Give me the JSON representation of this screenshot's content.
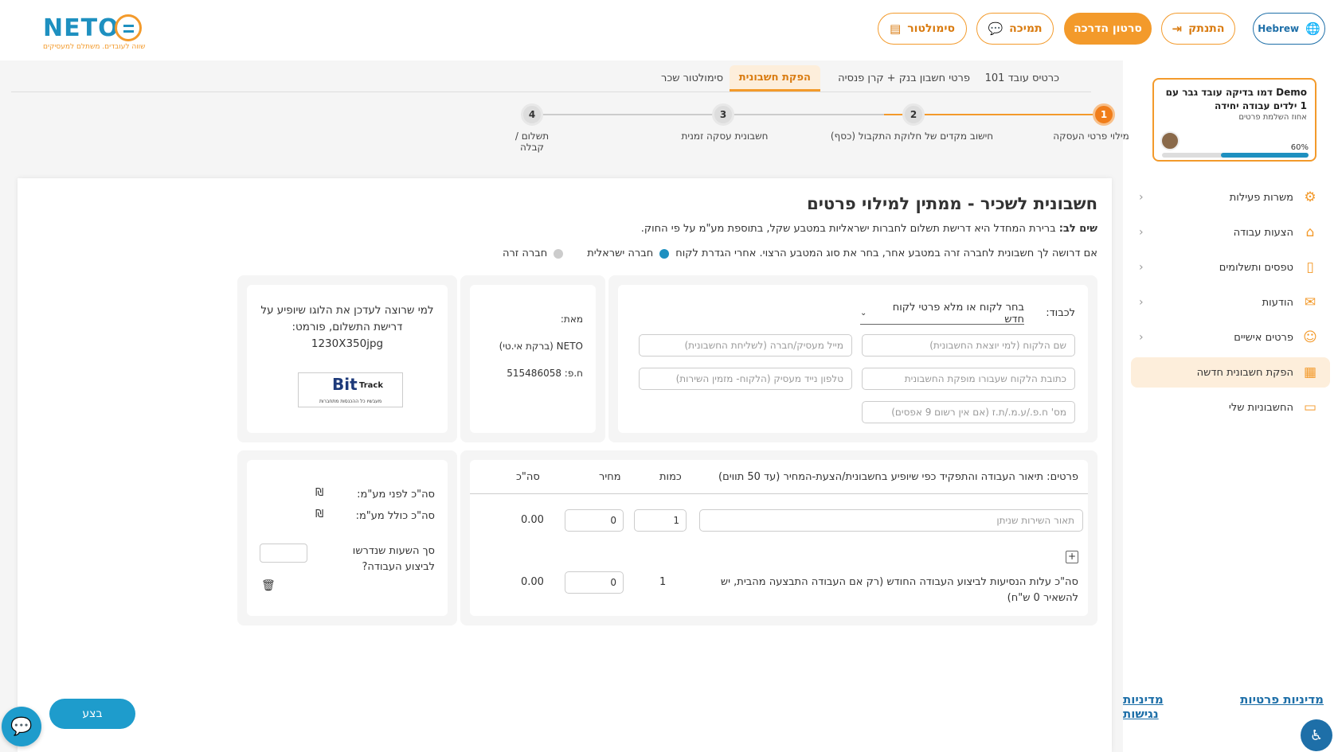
{
  "header": {
    "logo_text": "NETO",
    "logo_tagline": "שווה לעובדים. משתלם למעסיקים",
    "language_label": "Hebrew",
    "login_label": "התנתק",
    "guide_video_label": "סרטון הדרכה",
    "support_label": "תמיכה",
    "simulator_label": "סימולטור"
  },
  "demo_card": {
    "title": "Demo דמו בדיקה עובד גבר עם 1 ילדים עבודה יחידה",
    "subtitle": "אחוז השלמת פרטים",
    "percent_label": "60%",
    "percent": 0.6
  },
  "sidebar": {
    "items": [
      {
        "label": "משרות פעילות",
        "icon": "gear-icon"
      },
      {
        "label": "הצעות עבודה",
        "icon": "chair-icon"
      },
      {
        "label": "טפסים ותשלומים",
        "icon": "document-icon"
      },
      {
        "label": "הודעות",
        "icon": "envelope-icon"
      },
      {
        "label": "פרטים אישיים",
        "icon": "user-icon"
      },
      {
        "label": "הפקת חשבונית חדשה",
        "icon": "invoice-icon"
      },
      {
        "label": "החשבוניות שלי",
        "icon": "folder-icon"
      }
    ],
    "privacy_label": "מדיניות פרטיות",
    "accessibility_label": "מדיניות נגישות"
  },
  "tabs": [
    {
      "label": "כרטיס עובד 101"
    },
    {
      "label": "פרטי חשבון בנק + קרן פנסיה"
    },
    {
      "label": "הפקת חשבונית"
    },
    {
      "label": "סימולטור שכר"
    }
  ],
  "steps": [
    {
      "number": "1",
      "label": "מילוי פרטי העסקה"
    },
    {
      "number": "2",
      "label": "חישוב מקדים של חלוקת התקבול (כסף)"
    },
    {
      "number": "3",
      "label": "חשבונית עסקה זמנית"
    },
    {
      "number": "4",
      "label": "תשלום / קבלה"
    }
  ],
  "page": {
    "title": "חשבונית לשכיר - ממתין למילוי פרטים",
    "note_bold": "שים לב:",
    "note_text": "ברירת המחדל היא דרישת תשלום לחברות ישראליות במטבע שקל, בתוספת מע\"מ על פי החוק.",
    "currency_text": "אם דרושה לך חשבונית לחברה זרה במטבע אחר, בחר את סוג המטבע הרצוי. אחרי הגדרת לקוח",
    "radio_israeli": "חברה ישראלית",
    "radio_foreign": "חברה זרה"
  },
  "customer": {
    "to_label": "לכבוד:",
    "select_value": "בחר לקוח או מלא פרטי לקוח חדש",
    "customer_name_ph": "שם הלקוח (למי יוצאת החשבונית)",
    "employer_email_ph": "מייל מעסיק/חברה (לשליחת החשבונית)",
    "customer_address_ph": "כתובת הלקוח שעבורו מופקת החשבונית",
    "employer_phone_ph": "טלפון נייד מעסיק (הלקוח- מזמין השירות)",
    "tax_id_ph": "מס' ח.פ./ע.מ./ת.ז (אם אין רשום 9 אפסים)"
  },
  "from": {
    "label": "מאת:",
    "company": "NETO (ברקת אי.טי)",
    "company_id": "ח.פ: 515486058"
  },
  "logo_panel": {
    "text": "למי שרוצה לעדכן את הלוגו שיופיע על דרישת התשלום, פורמט: 1230X350jpg",
    "bit": "Bit",
    "track": "Track",
    "bit_sub": "מעבשיו כל ההכנסות מתחברות"
  },
  "items_table": {
    "header_desc": "פרטים: תיאור העבודה והתפקיד כפי שיופיע בחשבונית/הצעת-המחיר (עד 50 תווים)",
    "header_qty": "כמות",
    "header_price": "מחיר",
    "header_total": "סה\"כ",
    "row_desc_ph": "תאור השירות שניתן",
    "row_qty": "1",
    "row_price": "0",
    "row_total": "0.00",
    "travel_label": "סה\"כ עלות הנסיעות לביצוע העבודה החודש (רק אם העבודה התבצעה מהבית, יש להשאיר 0 ש\"ח)",
    "travel_qty": "1",
    "travel_price": "0",
    "travel_total": "0.00"
  },
  "totals": {
    "before_vat": "סה\"כ לפני מע\"מ:",
    "with_vat": "סה\"כ כולל מע\"מ:",
    "currency_symbol": "₪",
    "hours_label": "סך השעות שנדרשו לביצוע העבודה?"
  },
  "actions": {
    "submit_label": "בצע"
  },
  "colors": {
    "accent": "#f39a2b",
    "brand_blue": "#1e90c0",
    "link_blue": "#1e6fa8"
  }
}
